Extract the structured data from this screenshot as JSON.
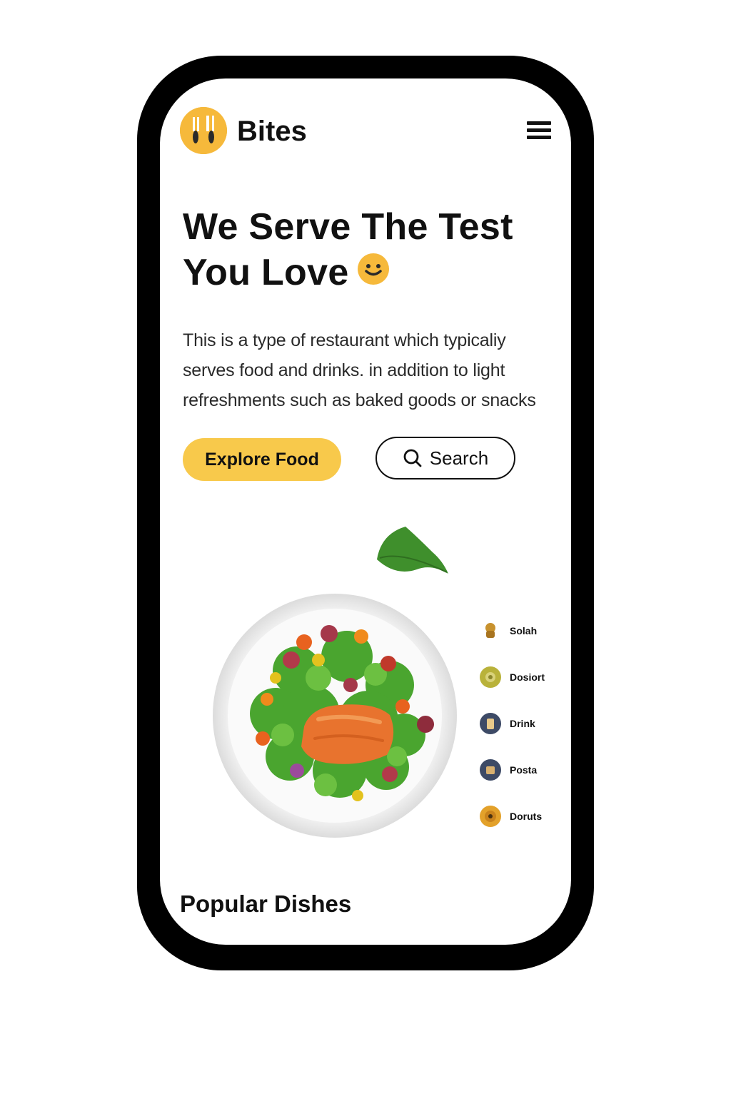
{
  "header": {
    "brand": "Bites",
    "logo_icon": "utensils-face-icon",
    "menu_icon": "hamburger-menu-icon"
  },
  "hero": {
    "title_line1": "We Serve The Test",
    "title_line2": "You Love",
    "title_icon": "smiley-emoji-icon",
    "description": "This is a type of restaurant which typicaliy serves food and drinks. in addition to light refreshments such as baked goods or snacks",
    "explore_label": "Explore Food",
    "search_label": "Search",
    "search_icon": "search-icon"
  },
  "categories": [
    {
      "label": "Solah",
      "icon": "salad-icon",
      "color": "#c8922e"
    },
    {
      "label": "Dosiort",
      "icon": "dessert-icon",
      "color": "#b9b23a"
    },
    {
      "label": "Drink",
      "icon": "drink-icon",
      "color": "#3d4a66"
    },
    {
      "label": "Posta",
      "icon": "pasta-icon",
      "color": "#3d4a66"
    },
    {
      "label": "Doruts",
      "icon": "donut-icon",
      "color": "#e3a12a"
    }
  ],
  "section": {
    "title": "Popular Dishes"
  },
  "colors": {
    "accent": "#f8c94b",
    "frame": "#000000",
    "text": "#111111"
  }
}
